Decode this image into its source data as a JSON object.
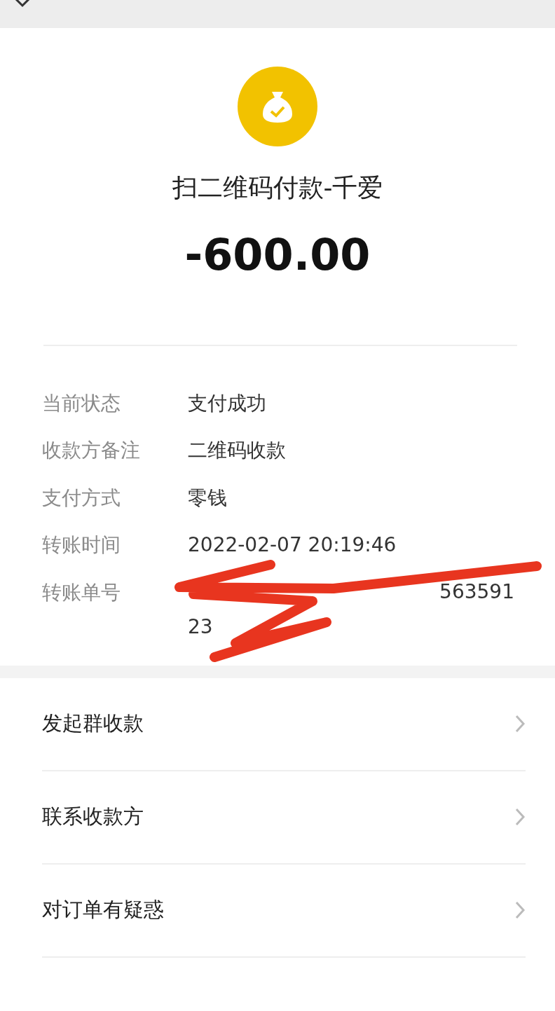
{
  "payment": {
    "title": "扫二维码付款-千爱",
    "amount": "-600.00"
  },
  "details": [
    {
      "label": "当前状态",
      "value": "支付成功"
    },
    {
      "label": "收款方备注",
      "value": "二维码收款"
    },
    {
      "label": "支付方式",
      "value": "零钱"
    },
    {
      "label": "转账时间",
      "value": "2022-02-07 20:19:46"
    },
    {
      "label": "转账单号",
      "value": "563591",
      "kind": "redacted",
      "tail": "23"
    }
  ],
  "actions": [
    {
      "label": "发起群收款"
    },
    {
      "label": "联系收款方"
    },
    {
      "label": "对订单有疑惑"
    }
  ]
}
